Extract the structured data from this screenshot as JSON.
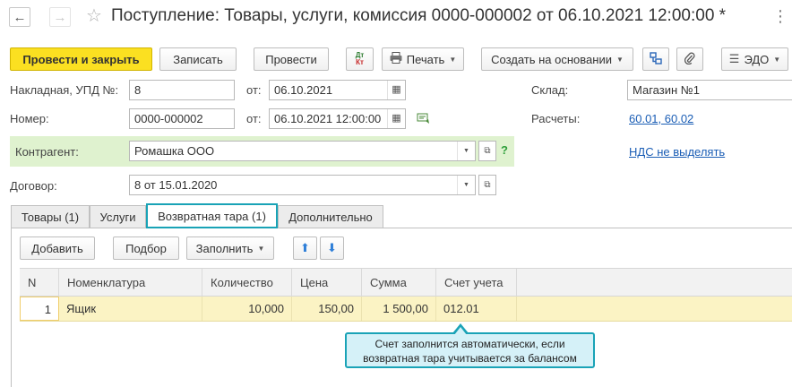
{
  "window": {
    "title": "Поступление: Товары, услуги, комиссия 0000-000002 от 06.10.2021 12:00:00 *"
  },
  "toolbar": {
    "post_and_close": "Провести и закрыть",
    "save": "Записать",
    "post": "Провести",
    "dt_kt_top": "Дт",
    "dt_kt_bottom": "Кт",
    "print": "Печать",
    "create_based_on": "Создать на основании",
    "edo": "ЭДО"
  },
  "form": {
    "invoice_label": "Накладная, УПД №:",
    "invoice_value": "8",
    "from_label": "от:",
    "invoice_date": "06.10.2021",
    "number_label": "Номер:",
    "number_value": "0000-000002",
    "number_datetime": "06.10.2021 12:00:00",
    "warehouse_label": "Склад:",
    "warehouse_value": "Магазин №1",
    "settlements_label": "Расчеты:",
    "settlements_link": "60.01, 60.02",
    "vat_link": "НДС не выделять",
    "counterparty_label": "Контрагент:",
    "counterparty_value": "Ромашка ООО",
    "help_mark": "?",
    "contract_label": "Договор:",
    "contract_value": "8 от 15.01.2020"
  },
  "tabs": [
    {
      "label": "Товары (1)"
    },
    {
      "label": "Услуги"
    },
    {
      "label": "Возвратная тара (1)"
    },
    {
      "label": "Дополнительно"
    }
  ],
  "table_toolbar": {
    "add": "Добавить",
    "pick": "Подбор",
    "fill": "Заполнить"
  },
  "table": {
    "columns": [
      "N",
      "Номенклатура",
      "Количество",
      "Цена",
      "Сумма",
      "Счет учета"
    ],
    "rows": [
      {
        "n": "1",
        "item": "Ящик",
        "qty": "10,000",
        "price": "150,00",
        "sum": "1 500,00",
        "account": "012.01"
      }
    ]
  },
  "tooltip": {
    "line1": "Счет заполнится автоматически, если",
    "line2": "возвратная тара учитывается за балансом"
  },
  "colors": {
    "primary_button": "#fbe021",
    "highlight_border": "#19a3b6",
    "link": "#1a5db5",
    "counterparty_bg": "#dff2cf",
    "selected_row": "#fbf3c4"
  }
}
